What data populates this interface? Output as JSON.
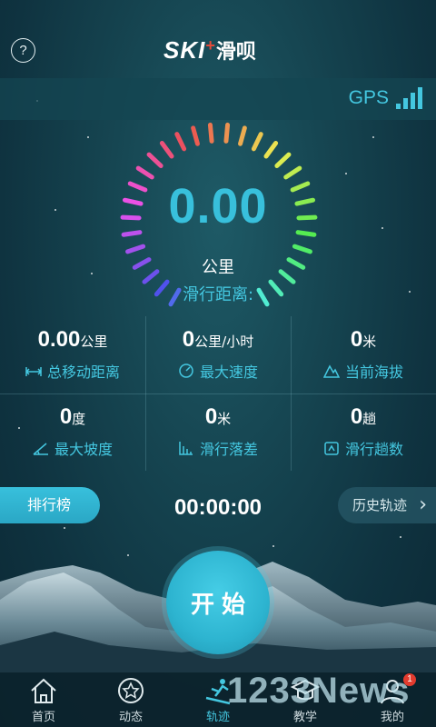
{
  "header": {
    "help_glyph": "?",
    "logo_text": "SKI",
    "logo_plus": "+",
    "logo_cn": "滑呗"
  },
  "gps": {
    "label": "GPS",
    "signal_color": "#44c7e0"
  },
  "gauge": {
    "value": "0.00",
    "unit": "公里",
    "label": "滑行距离:"
  },
  "stats": [
    {
      "value": "0.00",
      "unit": "公里",
      "label": "总移动距离",
      "icon": "distance-icon"
    },
    {
      "value": "0",
      "unit": "公里/小时",
      "label": "最大速度",
      "icon": "speed-icon"
    },
    {
      "value": "0",
      "unit": "米",
      "label": "当前海拔",
      "icon": "altitude-icon"
    },
    {
      "value": "0",
      "unit": "度",
      "label": "最大坡度",
      "icon": "slope-icon"
    },
    {
      "value": "0",
      "unit": "米",
      "label": "滑行落差",
      "icon": "drop-icon"
    },
    {
      "value": "0",
      "unit": "趟",
      "label": "滑行趟数",
      "icon": "runs-icon"
    }
  ],
  "controls": {
    "rank_label": "排行榜",
    "timer": "00:00:00",
    "history_label": "历史轨迹",
    "start_label": "开始"
  },
  "nav": [
    {
      "label": "首页",
      "icon": "home-icon"
    },
    {
      "label": "动态",
      "icon": "activity-icon"
    },
    {
      "label": "轨迹",
      "icon": "track-icon",
      "active": true
    },
    {
      "label": "教学",
      "icon": "teach-icon"
    },
    {
      "label": "我的",
      "icon": "profile-icon",
      "badge": "1"
    }
  ],
  "watermark": "1233News",
  "colors": {
    "accent": "#44c7e0",
    "badge": "#e23b2e"
  }
}
